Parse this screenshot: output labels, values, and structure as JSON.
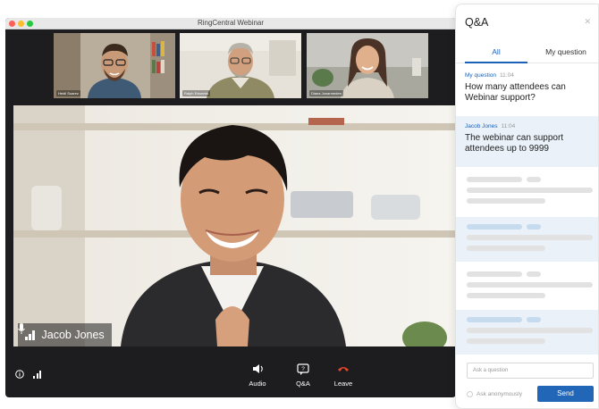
{
  "window": {
    "title": "RingCentral Webinar"
  },
  "participants": [
    {
      "name": "Heidi Suarez"
    },
    {
      "name": "Ralph Edwards"
    },
    {
      "name": "Diana Jonarmedee"
    }
  ],
  "speaker": {
    "name": "Jacob Jones"
  },
  "controls": {
    "audio_label": "Audio",
    "qa_label": "Q&A",
    "leave_label": "Leave"
  },
  "qa_panel": {
    "title": "Q&A",
    "tabs": [
      {
        "label": "All"
      },
      {
        "label": "My question"
      }
    ],
    "messages": [
      {
        "author": "My question",
        "time": "11:04",
        "text": "How many attendees can Webinar support?"
      },
      {
        "author": "Jacob Jones",
        "time": "11:04",
        "text": "The webinar can support attendees up to 9999"
      }
    ],
    "input_placeholder": "Ask a question",
    "anonymous_label": "Ask anonymously",
    "send_label": "Send"
  },
  "colors": {
    "accent": "#1a62b8",
    "leave": "#e8452c"
  }
}
